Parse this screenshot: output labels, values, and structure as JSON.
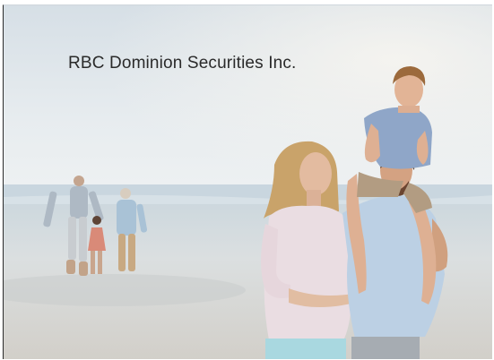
{
  "caption": {
    "text": "RBC Dominion Securities Inc."
  },
  "photo": {
    "subject": "beach-family-photo",
    "palette": {
      "sky": "#e4eaee",
      "sea": "#cbd8e2",
      "sand": "#d9d8d4",
      "accent_blouse": "#e8dbe0",
      "accent_shirt": "#b9cde2"
    }
  }
}
